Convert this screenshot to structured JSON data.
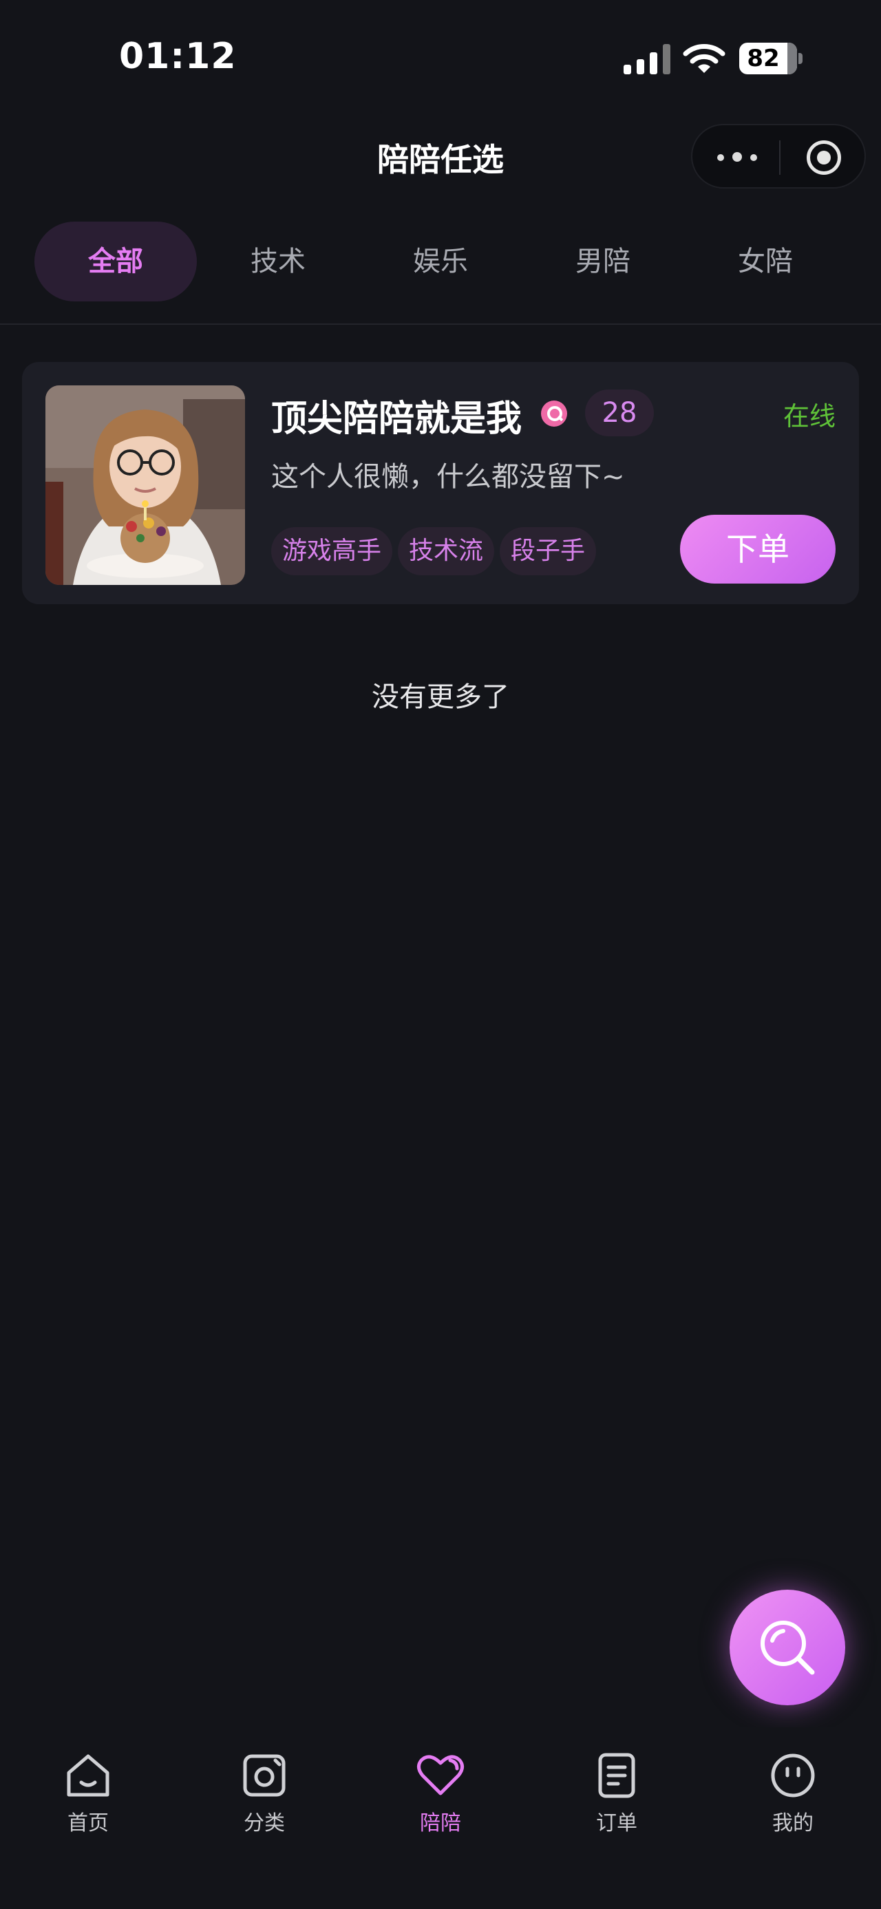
{
  "status_bar": {
    "time": "01:12",
    "battery": "82"
  },
  "nav": {
    "title": "陪陪任选"
  },
  "tabs": [
    {
      "label": "全部",
      "active": true
    },
    {
      "label": "技术",
      "active": false
    },
    {
      "label": "娱乐",
      "active": false
    },
    {
      "label": "男陪",
      "active": false
    },
    {
      "label": "女陪",
      "active": false
    }
  ],
  "card": {
    "name": "顶尖陪陪就是我",
    "age": "28",
    "status": "在线",
    "description": "这个人很懒，什么都没留下~",
    "tags": [
      "游戏高手",
      "技术流",
      "段子手"
    ],
    "order_button": "下单"
  },
  "list_footer": "没有更多了",
  "tabbar": [
    {
      "label": "首页",
      "icon": "home-icon"
    },
    {
      "label": "分类",
      "icon": "category-icon"
    },
    {
      "label": "陪陪",
      "icon": "heart-icon",
      "active": true
    },
    {
      "label": "订单",
      "icon": "order-icon"
    },
    {
      "label": "我的",
      "icon": "profile-icon"
    }
  ],
  "colors": {
    "accent": "#e57df3",
    "online": "#5fc238",
    "background": "#131419"
  }
}
